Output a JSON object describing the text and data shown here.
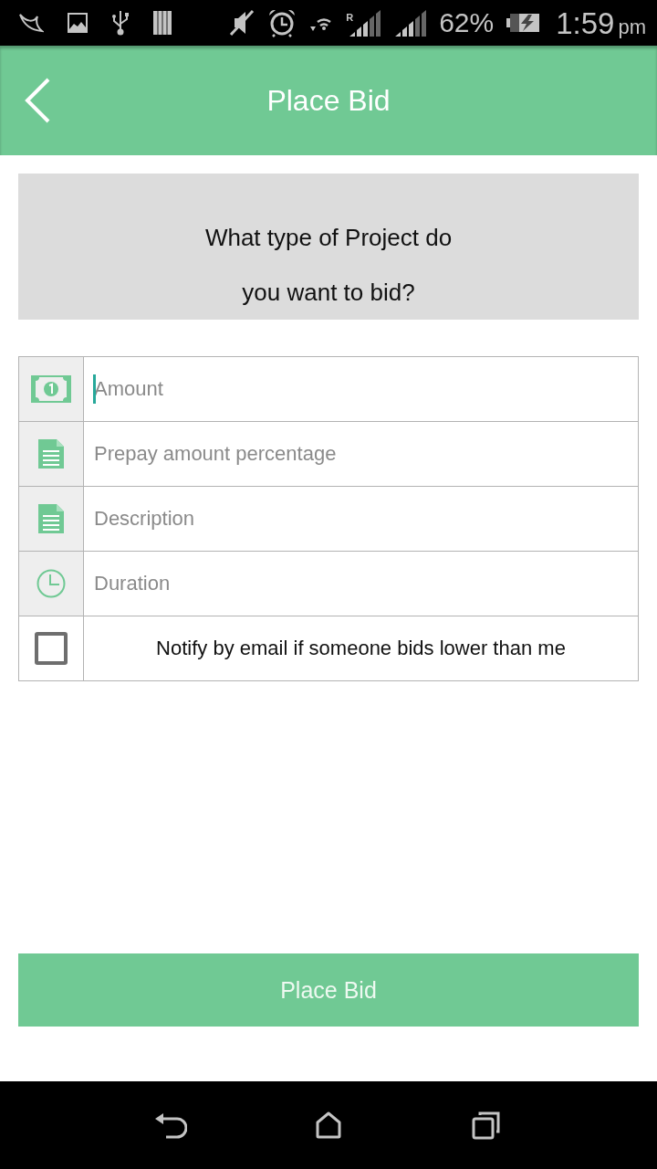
{
  "status_bar": {
    "roaming_label": "R",
    "battery": "62%",
    "time": "1:59",
    "time_suffix": "pm"
  },
  "app_bar": {
    "title": "Place Bid"
  },
  "prompt": {
    "lines": [
      "What type of Project do",
      "you want to bid?"
    ]
  },
  "form": {
    "fields": [
      {
        "kind": "amount",
        "placeholder": "Amount",
        "focused": true
      },
      {
        "kind": "document",
        "placeholder": "Prepay amount percentage",
        "focused": false
      },
      {
        "kind": "document",
        "placeholder": "Description",
        "focused": false
      },
      {
        "kind": "duration",
        "placeholder": "Duration",
        "focused": false
      }
    ],
    "notify": {
      "label": "Notify by email if someone bids lower than me",
      "checked": false
    }
  },
  "submit_button": {
    "label": "Place Bid"
  }
}
